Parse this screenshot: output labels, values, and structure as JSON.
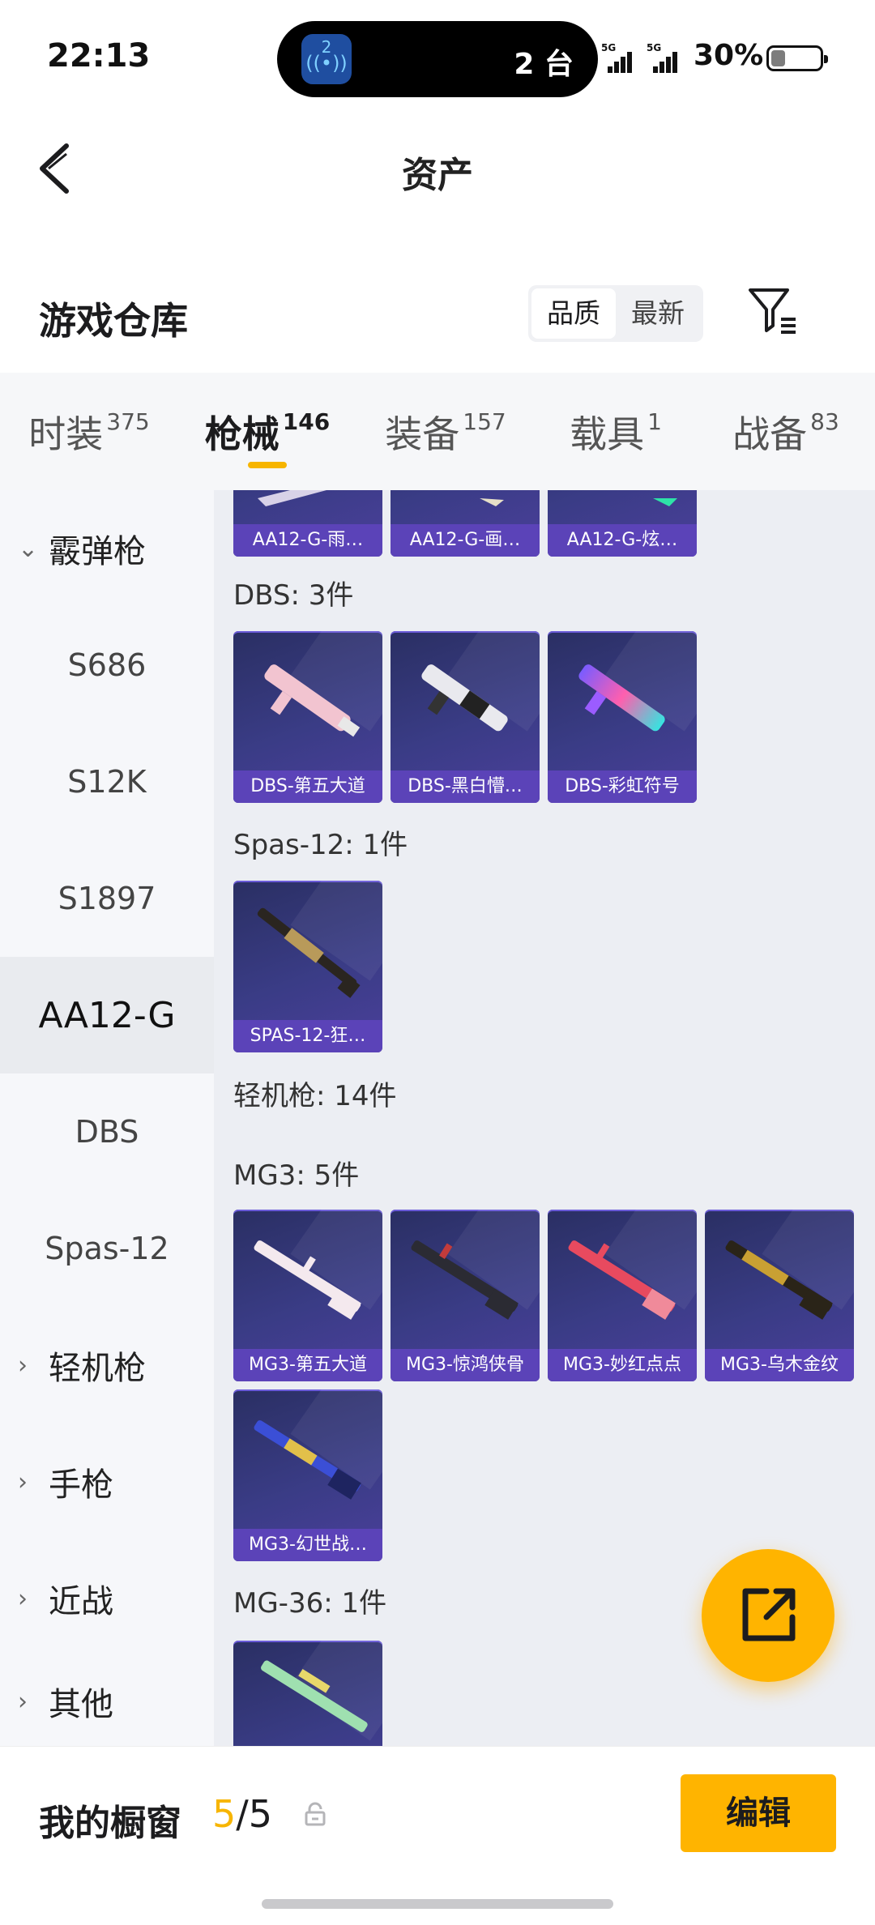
{
  "status_bar": {
    "time": "22:13",
    "island_count": "2 台",
    "island_badge": "2",
    "network_1": "5G",
    "network_2": "5G",
    "battery_percent": "30%",
    "battery_level": 0.3
  },
  "nav": {
    "title": "资产"
  },
  "header": {
    "title": "游戏仓库",
    "sort_options": [
      "品质",
      "最新"
    ],
    "sort_selected": "品质"
  },
  "tabs": [
    {
      "label": "时装",
      "count": "375"
    },
    {
      "label": "枪械",
      "count": "146"
    },
    {
      "label": "装备",
      "count": "157"
    },
    {
      "label": "载具",
      "count": "1"
    },
    {
      "label": "战备",
      "count": "83"
    }
  ],
  "active_tab": "枪械",
  "sidebar": {
    "items": [
      {
        "label": "霰弹枪",
        "type": "group",
        "expanded": true
      },
      {
        "label": "S686",
        "type": "sub"
      },
      {
        "label": "S12K",
        "type": "sub"
      },
      {
        "label": "S1897",
        "type": "sub"
      },
      {
        "label": "AA12-G",
        "type": "sub",
        "selected": true
      },
      {
        "label": "DBS",
        "type": "sub"
      },
      {
        "label": "Spas-12",
        "type": "sub"
      },
      {
        "label": "轻机枪",
        "type": "group",
        "expanded": false
      },
      {
        "label": "手枪",
        "type": "group",
        "expanded": false
      },
      {
        "label": "近战",
        "type": "group",
        "expanded": false
      },
      {
        "label": "其他",
        "type": "group",
        "expanded": false
      }
    ]
  },
  "content": {
    "aa12_cards": [
      "AA12-G-雨…",
      "AA12-G-画…",
      "AA12-G-炫…"
    ],
    "dbs": {
      "label": "DBS: 3件",
      "cards": [
        "DBS-第五大道",
        "DBS-黑白懵…",
        "DBS-彩虹符号"
      ]
    },
    "spas": {
      "label": "Spas-12: 1件",
      "cards": [
        "SPAS-12-狂…"
      ]
    },
    "lmg_label": "轻机枪: 14件",
    "mg3": {
      "label": "MG3: 5件",
      "cards": [
        "MG3-第五大道",
        "MG3-惊鸿侠骨",
        "MG3-妙红点点",
        "MG3-乌木金纹",
        "MG3-幻世战…"
      ]
    },
    "mg36": {
      "label": "MG-36: 1件",
      "cards": [
        ""
      ]
    }
  },
  "bottom_bar": {
    "showcase_label": "我的橱窗",
    "current": "5",
    "total": "/5",
    "edit_label": "编辑"
  },
  "colors": {
    "accent": "#ffb400",
    "card_caption": "#5b43b8",
    "card_bg": "#3a3c86"
  }
}
